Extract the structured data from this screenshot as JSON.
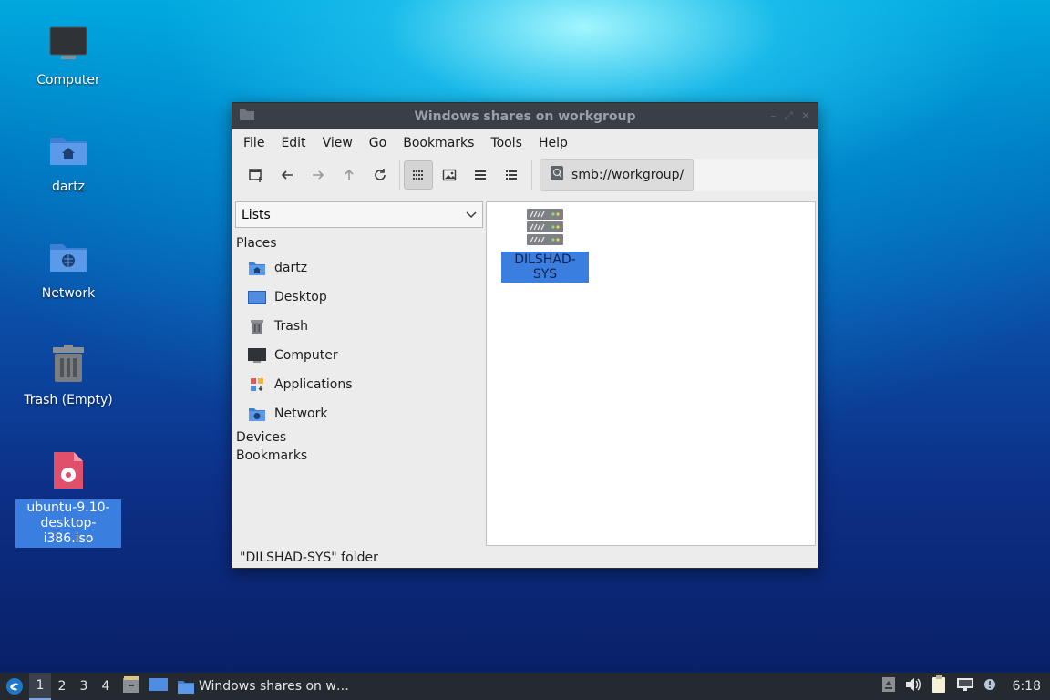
{
  "desktop": {
    "icons": [
      {
        "label": "Computer",
        "icon": "computer-icon"
      },
      {
        "label": "dartz",
        "icon": "home-folder-icon"
      },
      {
        "label": "Network",
        "icon": "network-folder-icon"
      },
      {
        "label": "Trash (Empty)",
        "icon": "trash-icon"
      },
      {
        "label": "ubuntu-9.10-\ndesktop-i386.iso",
        "label_line1": "ubuntu-9.10-",
        "label_line2": "desktop-i386.iso",
        "icon": "disc-image-icon",
        "selected": true
      }
    ]
  },
  "window": {
    "title": "Windows shares on workgroup",
    "menu": [
      "File",
      "Edit",
      "View",
      "Go",
      "Bookmarks",
      "Tools",
      "Help"
    ],
    "toolbar": {
      "buttons": [
        "new-tab-icon",
        "back-icon",
        "forward-icon",
        "up-icon",
        "reload-icon",
        "icon-view-icon",
        "thumbnail-view-icon",
        "compact-view-icon",
        "detailed-view-icon"
      ],
      "active_view": "icon-view"
    },
    "location": "smb://workgroup/",
    "side_combo": "Lists",
    "places_header": "Places",
    "places": [
      {
        "label": "dartz",
        "icon": "home-folder-icon"
      },
      {
        "label": "Desktop",
        "icon": "desktop-icon"
      },
      {
        "label": "Trash",
        "icon": "trash-icon"
      },
      {
        "label": "Computer",
        "icon": "computer-icon"
      },
      {
        "label": "Applications",
        "icon": "applications-icon"
      },
      {
        "label": "Network",
        "icon": "network-folder-icon"
      }
    ],
    "devices_header": "Devices",
    "bookmarks_header": "Bookmarks",
    "files": [
      {
        "label": "DILSHAD-SYS",
        "icon": "server-icon",
        "selected": true
      }
    ],
    "status": "\"DILSHAD-SYS\" folder"
  },
  "panel": {
    "workspaces": [
      "1",
      "2",
      "3",
      "4"
    ],
    "active_workspace": "1",
    "task_label": "Windows shares on w…",
    "clock": "6:18"
  },
  "colors": {
    "selection": "#3a7ee0",
    "titlebar": "#3a3f46",
    "panel": "#252a31"
  }
}
